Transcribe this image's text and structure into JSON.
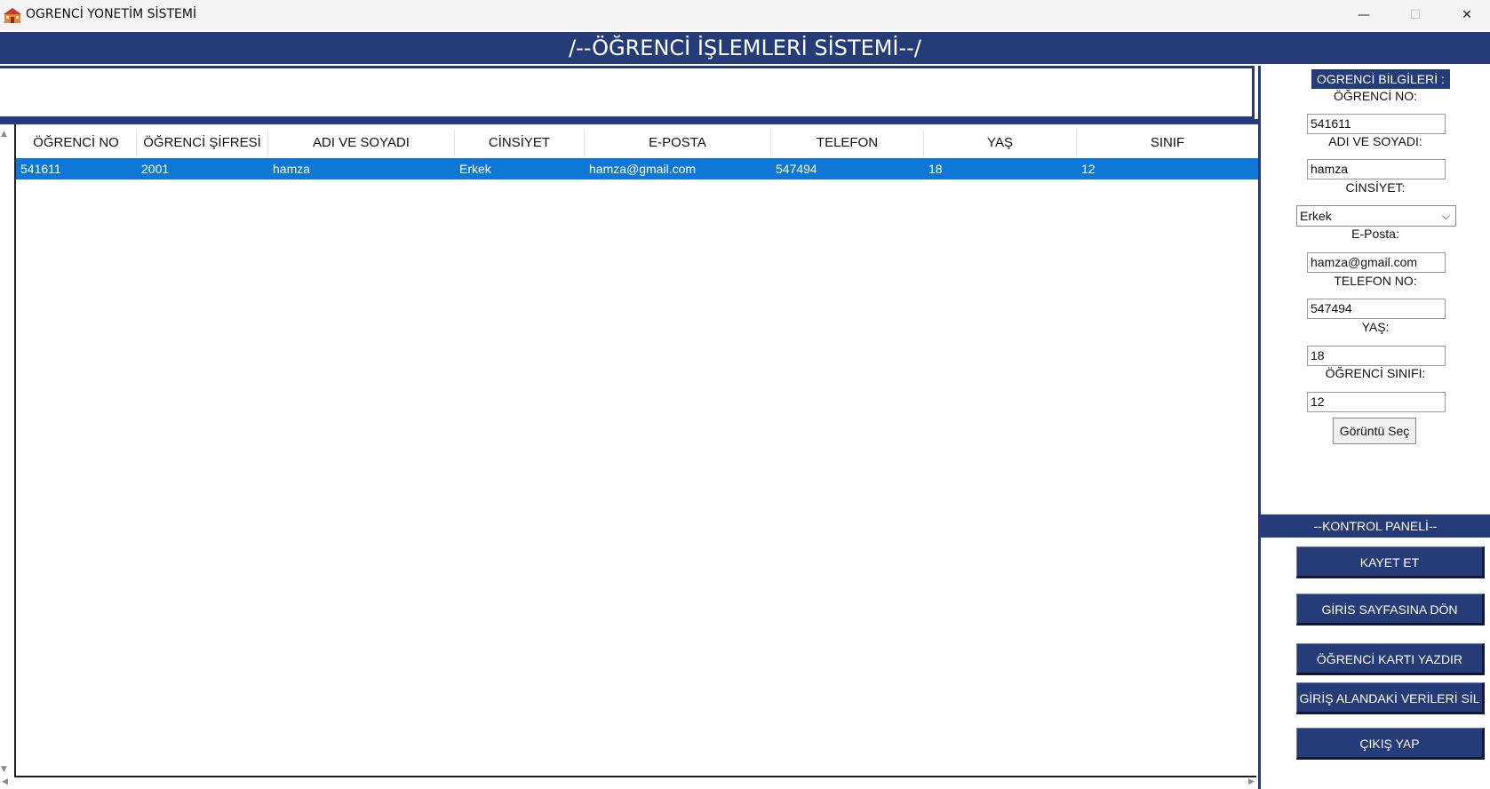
{
  "window": {
    "title": "OGRENCİ YONETİM SİSTEMİ",
    "minimize_glyph": "—",
    "maximize_glyph": "☐",
    "close_glyph": "✕"
  },
  "banner": {
    "title": "/--ÖĞRENCİ İŞLEMLERİ SİSTEMİ--/"
  },
  "table": {
    "columns": [
      "ÖĞRENCİ NO",
      "ÖĞRENCİ ŞİFRESİ",
      "ADI VE SOYADI",
      "CİNSİYET",
      "E-POSTA",
      "TELEFON",
      "YAŞ",
      "SINIF"
    ],
    "rows": [
      [
        "541611",
        "2001",
        "hamza",
        "Erkek",
        "hamza@gmail.com",
        "547494",
        "18",
        "12"
      ]
    ]
  },
  "form": {
    "section_title": "OGRENCİ BİLGİLERİ :",
    "student_no_label": "ÖĞRENCİ NO:",
    "student_no_value": "541611",
    "name_label": "ADI VE SOYADI:",
    "name_value": "hamza",
    "gender_label": "CİNSİYET:",
    "gender_value": "Erkek",
    "email_label": "E-Posta:",
    "email_value": "hamza@gmail.com",
    "phone_label": "TELEFON NO:",
    "phone_value": "547494",
    "age_label": "YAŞ:",
    "age_value": "18",
    "class_label": "ÖĞRENCİ SINIFI:",
    "class_value": "12",
    "image_button": "Görüntü Seç"
  },
  "control_panel": {
    "title": "--KONTROL PANELİ--",
    "save": "KAYET ET",
    "back_to_login": "GİRİS SAYFASINA DÖN",
    "print_card": "ÖĞRENCİ KARTI YAZDIR",
    "clear_fields": "GİRİŞ ALANDAKİ VERİLERİ SİL",
    "exit": "ÇIKIŞ YAP"
  },
  "colors": {
    "brand_navy": "#253c78",
    "selection_blue": "#0f78d7"
  },
  "icons": {
    "app": "school-building-icon",
    "select_chevron": "chevron-down-icon"
  }
}
